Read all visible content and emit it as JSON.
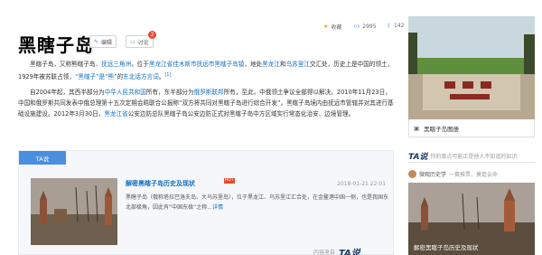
{
  "article": {
    "title": "黑瞎子岛",
    "edit_label": "编辑",
    "discuss_label": "讨论",
    "discuss_count": "2"
  },
  "stats": {
    "favorite_label": "收藏",
    "likes": "2995",
    "shares": "142"
  },
  "intro": {
    "p1": [
      {
        "t": "黑瞎子岛，又称熊瞎子岛、"
      },
      {
        "t": "抚远三角洲",
        "link": true
      },
      {
        "t": "，位于"
      },
      {
        "t": "黑龙江省佳木斯市抚远市黑瞎子岛镇",
        "link": true
      },
      {
        "t": "，地处"
      },
      {
        "t": "黑龙江",
        "link": true
      },
      {
        "t": "和"
      },
      {
        "t": "乌苏里江",
        "link": true
      },
      {
        "t": "交汇处，历史上是中国的领土，1929年被苏联占领，"
      },
      {
        "t": "“黑瞎子”是“熊”",
        "link": true
      },
      {
        "t": "的"
      },
      {
        "t": "东北话方言词",
        "link": true
      },
      {
        "t": "。"
      },
      {
        "t": "[1]",
        "sup": true
      }
    ],
    "p2": [
      {
        "t": "自2004年起，其西半部分为"
      },
      {
        "t": "中华人民共和国",
        "link": true
      },
      {
        "t": "所有，东半部分为"
      },
      {
        "t": "俄罗斯联邦",
        "link": true
      },
      {
        "t": "所有，至此，中俄领土争议全部得以解决。2010年11月23日，中国和俄罗斯共同发表中俄总理第十五次定期会晤联合公报称“双方将共同对黑瞎子岛进行综合开发”，黑瞎子岛境内由抚远市管辖并对其进行基础设施建设。2012年3月30日，"
      },
      {
        "t": "黑龙江省",
        "link": true
      },
      {
        "t": "公安边防总队黑瞎子岛公安边防正式对黑瞎子岛中方区域实行常态化治安、边境管理。"
      }
    ]
  },
  "ta": {
    "tab_label": "TA说",
    "article_title": "解密黑瞎子岛历史及现状",
    "hot": "HOT",
    "date": "2018-01-21 22:01",
    "summary": "黑瞎子岛（俄称塔拉巴洛夫岛、大乌苏里岛），位于黑龙江、乌苏里江汇合处，在金鳌港中国一侧，也是我国东北部极角，因此有“中国东极”之称...",
    "more": "详情",
    "source_prefix": "内容来自",
    "source_logo": "TA说"
  },
  "sidebar": {
    "album_label": "黑瞎子岛图册",
    "ta_logo": "TA说",
    "ta_subtitle": "你的观点可能正是他人不知道的知识",
    "author": "微观历史学",
    "author_sub": "一赛推票，莫筵云命",
    "card_caption": "解密黑瞎子岛历史及现状"
  }
}
